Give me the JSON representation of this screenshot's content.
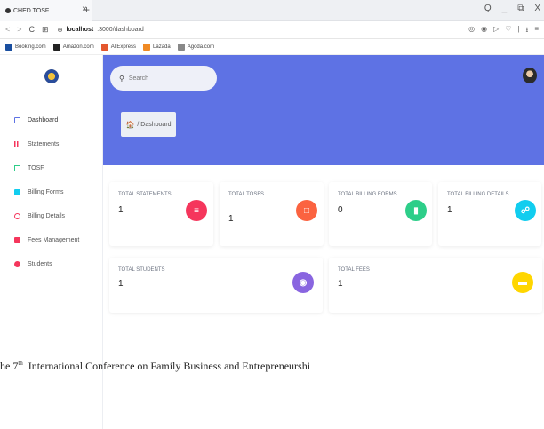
{
  "browser": {
    "tab_title": "CHED TOSF",
    "tab_close": "×",
    "new_tab": "+",
    "url_host": "localhost",
    "url_path": ":3000/dashboard",
    "nav_back": "<",
    "nav_forward": ">",
    "nav_reload": "C",
    "nav_grid": "⊞",
    "nav_security": "⊕",
    "tools": [
      "◎",
      "◉",
      "▷",
      "♡",
      "|",
      "⭳",
      "≡"
    ],
    "win_min": "Q",
    "win_max": "_",
    "win_restore": "⧉",
    "win_close": "X"
  },
  "bookmarks": [
    {
      "label": "Booking.com",
      "color": "#1a4fa0"
    },
    {
      "label": "Amazon.com",
      "color": "#222222"
    },
    {
      "label": "AliExpress",
      "color": "#e4572e"
    },
    {
      "label": "Lazada",
      "color": "#f08a24"
    },
    {
      "label": "Agoda.com",
      "color": "#888888"
    }
  ],
  "sidebar": {
    "items": [
      {
        "label": "Dashboard",
        "color": "#5e72e4"
      },
      {
        "label": "Statements",
        "color": "#f5365c"
      },
      {
        "label": "TOSF",
        "color": "#2dce89"
      },
      {
        "label": "Billing Forms",
        "color": "#11cdef"
      },
      {
        "label": "Billing Details",
        "color": "#f5365c"
      },
      {
        "label": "Fees Management",
        "color": "#f5365c"
      },
      {
        "label": "Students",
        "color": "#f5365c"
      }
    ]
  },
  "search": {
    "placeholder": "Search",
    "icon": "search-icon"
  },
  "breadcrumb": {
    "home": "🏠",
    "text": "/ Dashboard"
  },
  "cards": [
    {
      "label": "TOTAL STATEMENTS",
      "value": "1",
      "color": "#f5365c",
      "icon": "statements-icon"
    },
    {
      "label": "TOTAL TOSFS",
      "value": "1",
      "color": "#fb6340",
      "icon": "tosf-icon"
    },
    {
      "label": "TOTAL BILLING FORMS",
      "value": "0",
      "color": "#2dce89",
      "icon": "billing-forms-icon"
    },
    {
      "label": "TOTAL BILLING DETAILS",
      "value": "1",
      "color": "#11cdef",
      "icon": "billing-details-icon"
    },
    {
      "label": "TOTAL STUDENTS",
      "value": "1",
      "color": "#8965e0",
      "icon": "students-icon"
    },
    {
      "label": "TOTAL FEES",
      "value": "1",
      "color": "#ffd600",
      "icon": "fees-icon"
    }
  ],
  "footer": {
    "prefix": "he 7",
    "sup": "th",
    "rest": "  International Conference on Family Business and Entrepreneurshi"
  }
}
